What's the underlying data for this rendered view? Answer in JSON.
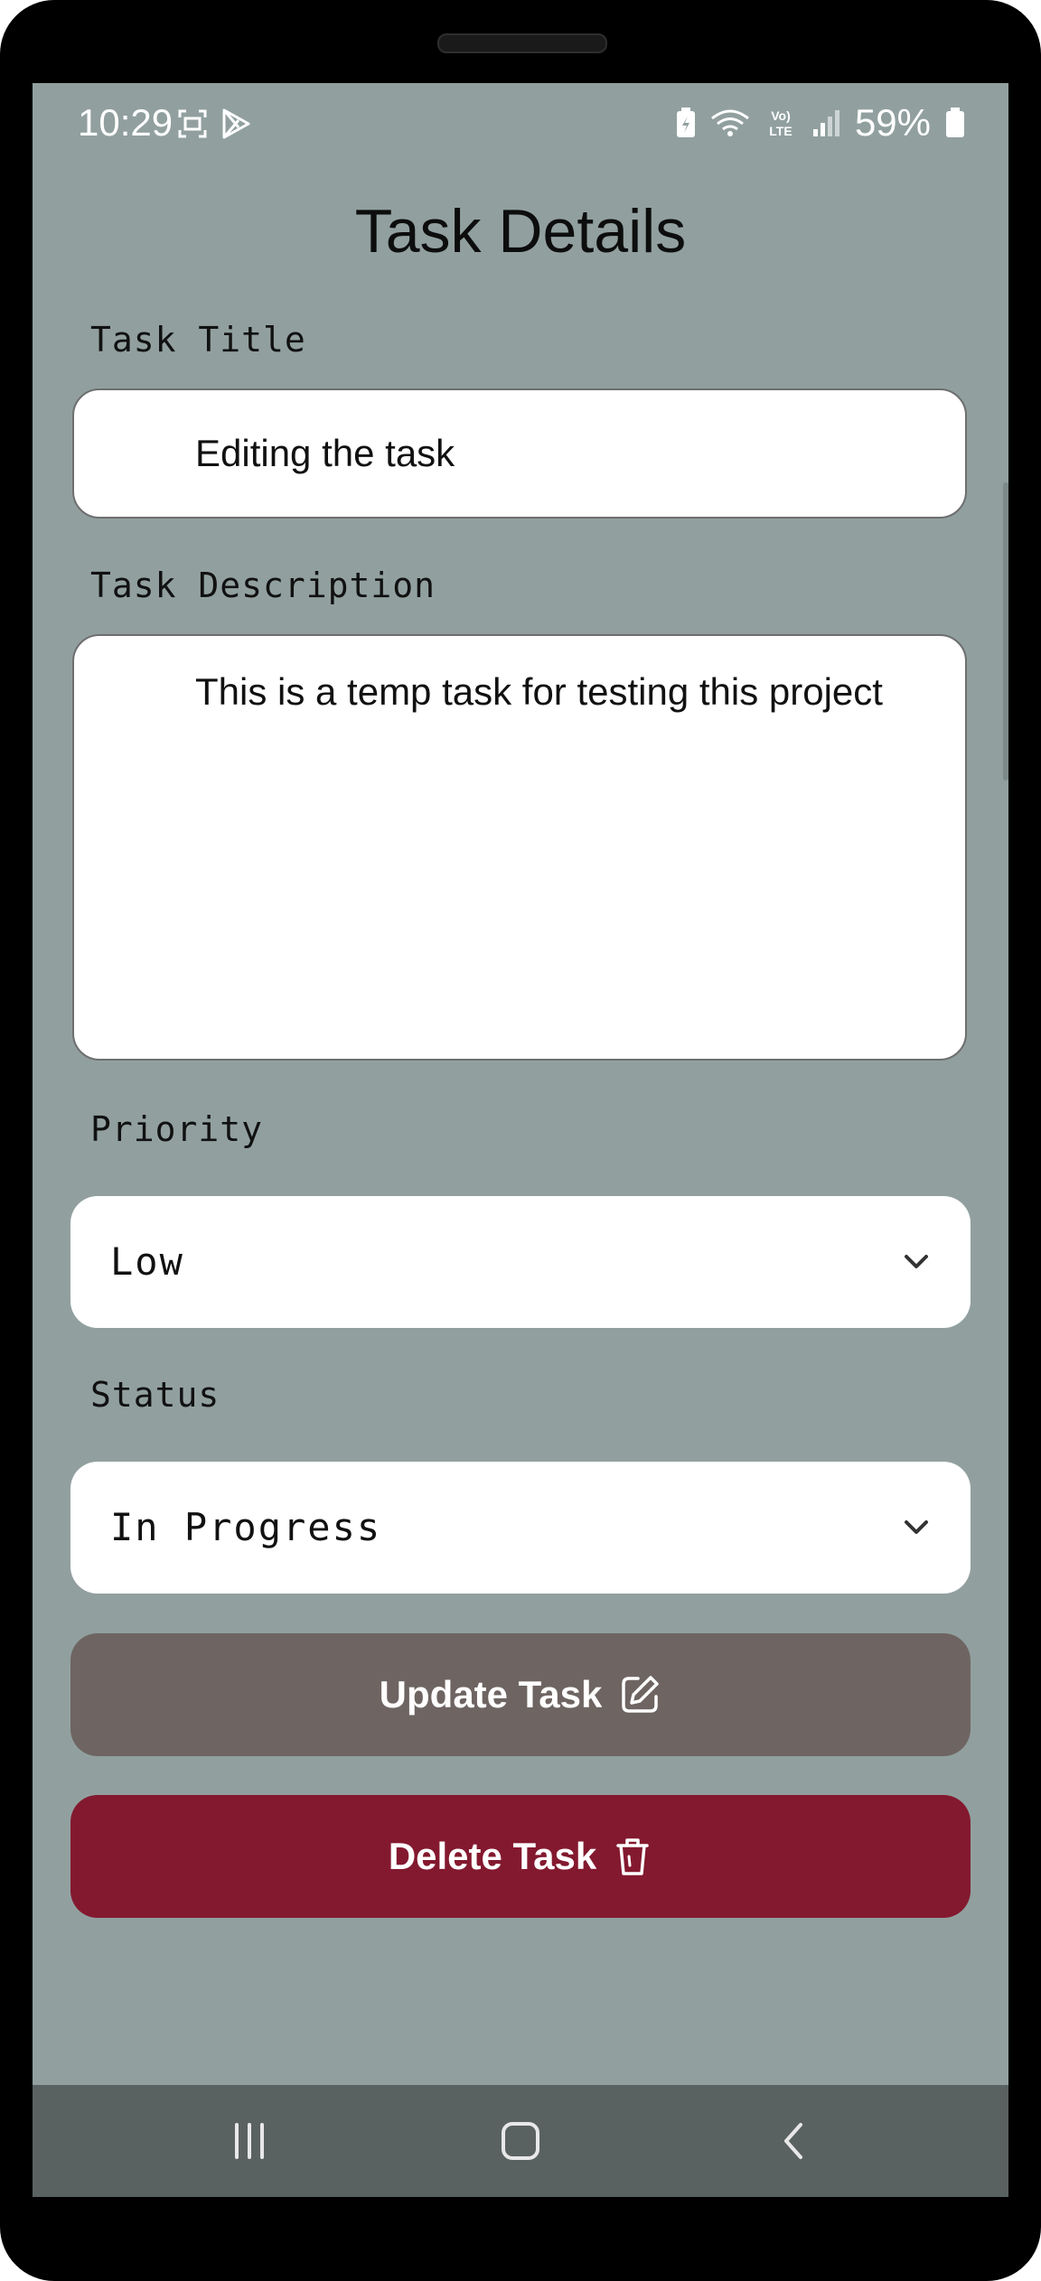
{
  "status_bar": {
    "time": "10:29",
    "battery_percent": "59%",
    "network_label": "Vo) LTE",
    "left_icons": [
      "screenshot-icon",
      "play-store-icon"
    ],
    "right_icons": [
      "battery-saver-icon",
      "wifi-icon",
      "volte-icon",
      "signal-icon",
      "battery-icon"
    ]
  },
  "header": {
    "title": "Task Details"
  },
  "form": {
    "title_label": "Task Title",
    "title_value": "Editing the task",
    "description_label": "Task Description",
    "description_value": "This is a temp task for testing this project",
    "priority_label": "Priority",
    "priority_value": "Low",
    "status_label": "Status",
    "status_value": "In Progress"
  },
  "actions": {
    "update_label": "Update Task",
    "update_icon": "edit-icon",
    "delete_label": "Delete Task",
    "delete_icon": "trash-icon"
  },
  "nav": {
    "items": [
      "recent-apps-icon",
      "home-icon",
      "back-icon"
    ]
  },
  "colors": {
    "background": "#91a09f",
    "update_button": "#6e6562",
    "delete_button": "#83192f",
    "nav_bar": "#5a6261"
  }
}
